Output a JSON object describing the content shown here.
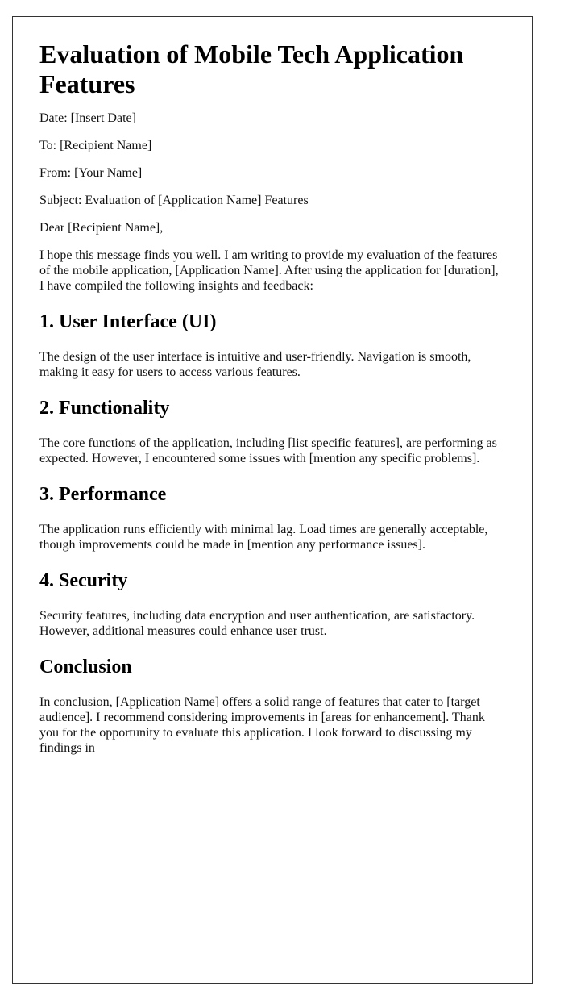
{
  "document": {
    "title": "Evaluation of Mobile Tech Application Features",
    "header_lines": {
      "date": "Date: [Insert Date]",
      "to": "To: [Recipient Name]",
      "from": "From: [Your Name]",
      "subject": "Subject: Evaluation of [Application Name] Features"
    },
    "salutation": "Dear [Recipient Name],",
    "intro": "I hope this message finds you well. I am writing to provide my evaluation of the features of the mobile application, [Application Name]. After using the application for [duration], I have compiled the following insights and feedback:",
    "sections": [
      {
        "heading": "1. User Interface (UI)",
        "body": "The design of the user interface is intuitive and user-friendly. Navigation is smooth, making it easy for users to access various features."
      },
      {
        "heading": "2. Functionality",
        "body": "The core functions of the application, including [list specific features], are performing as expected. However, I encountered some issues with [mention any specific problems]."
      },
      {
        "heading": "3. Performance",
        "body": "The application runs efficiently with minimal lag. Load times are generally acceptable, though improvements could be made in [mention any performance issues]."
      },
      {
        "heading": "4. Security",
        "body": "Security features, including data encryption and user authentication, are satisfactory. However, additional measures could enhance user trust."
      },
      {
        "heading": "Conclusion",
        "body": "In conclusion, [Application Name] offers a solid range of features that cater to [target audience]. I recommend considering improvements in [areas for enhancement]. Thank you for the opportunity to evaluate this application. I look forward to discussing my findings in"
      }
    ]
  }
}
